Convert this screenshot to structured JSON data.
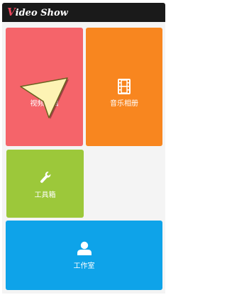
{
  "app": {
    "title_v": "V",
    "title_rest": "ideo Show"
  },
  "tiles": {
    "video_edit": {
      "label": "视频编辑",
      "color": "#f5646a",
      "icon": "clapperboard-icon"
    },
    "music_album": {
      "label": "音乐相册",
      "color": "#f8861f",
      "icon": "film-strip-icon"
    },
    "toolbox": {
      "label": "工具箱",
      "color": "#9cc83a",
      "icon": "wrench-icon"
    },
    "studio": {
      "label": "工作室",
      "color": "#0ea3e9",
      "icon": "person-icon"
    }
  },
  "cursor": {
    "icon": "pointer-arrow-icon"
  }
}
